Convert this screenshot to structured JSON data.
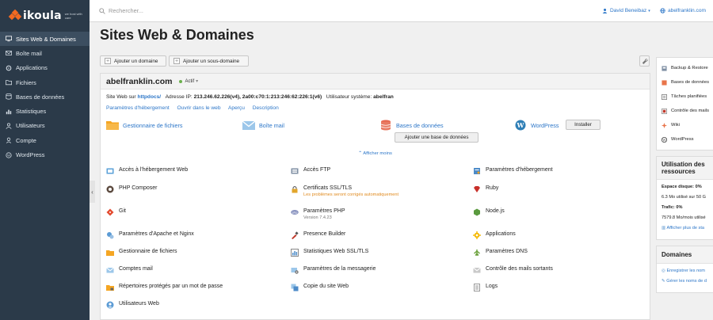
{
  "brand": {
    "name": "ikoula",
    "tagline": "we host with care"
  },
  "sidebar": {
    "items": [
      {
        "label": "Sites Web & Domaines",
        "icon": "monitor-icon",
        "active": true
      },
      {
        "label": "Boîte mail",
        "icon": "mail-icon"
      },
      {
        "label": "Applications",
        "icon": "applications-icon"
      },
      {
        "label": "Fichiers",
        "icon": "folder-icon"
      },
      {
        "label": "Bases de données",
        "icon": "database-icon"
      },
      {
        "label": "Statistiques",
        "icon": "statistics-icon"
      },
      {
        "label": "Utilisateurs",
        "icon": "users-icon"
      },
      {
        "label": "Compte",
        "icon": "account-icon"
      },
      {
        "label": "WordPress",
        "icon": "wordpress-icon"
      }
    ]
  },
  "header": {
    "search_placeholder": "Rechercher...",
    "user_name": "David Beneibaz",
    "domain": "abelfranklin.com"
  },
  "page": {
    "title": "Sites Web & Domaines",
    "add_domain": "Ajouter un domaine",
    "add_subdomain": "Ajouter un sous-domaine"
  },
  "site": {
    "name": "abelfranklin.com",
    "status": "Actif",
    "info_prefix": "Site Web sur",
    "docroot": "httpdocs/",
    "ip_label": "Adresse IP:",
    "ip_value": "213.246.62.226(v4), 2a00:c70:1:213:246:62:226:1(v6)",
    "sysuser_label": "Utilisateur système:",
    "sysuser_value": "abelfran",
    "links": [
      "Paramètres d'hébergement",
      "Ouvrir dans le web",
      "Aperçu",
      "Description"
    ],
    "quick": [
      {
        "label": "Gestionnaire de fichiers",
        "icon": "folder-icon"
      },
      {
        "label": "Boîte mail",
        "icon": "mail-icon"
      },
      {
        "label": "Bases de données",
        "icon": "database-icon"
      },
      {
        "label": "WordPress",
        "icon": "wordpress-icon"
      }
    ],
    "install_button": "Installer",
    "add_db_button": "Ajouter une base de données",
    "show_less": "⌃ Afficher moins"
  },
  "features": [
    {
      "label": "Accès à l'hébergement Web",
      "icon": "web-access-icon"
    },
    {
      "label": "Accès FTP",
      "icon": "ftp-icon"
    },
    {
      "label": "Paramètres d'hébergement",
      "icon": "hosting-settings-icon"
    },
    {
      "label": "PHP Composer",
      "icon": "php-composer-icon"
    },
    {
      "label": "Certificats SSL/TLS",
      "icon": "ssl-certificate-icon",
      "sub": "Les problèmes seront corrigés automatiquement"
    },
    {
      "label": "Ruby",
      "icon": "ruby-icon"
    },
    {
      "label": "Git",
      "icon": "git-icon"
    },
    {
      "label": "Paramètres PHP",
      "icon": "php-icon",
      "sub": "Version 7.4.23"
    },
    {
      "label": "Node.js",
      "icon": "nodejs-icon"
    },
    {
      "label": "Paramètres d'Apache et Nginx",
      "icon": "apache-nginx-icon"
    },
    {
      "label": "Presence Builder",
      "icon": "presence-builder-icon"
    },
    {
      "label": "Applications",
      "icon": "applications-icon"
    },
    {
      "label": "Gestionnaire de fichiers",
      "icon": "folder-icon"
    },
    {
      "label": "Statistiques Web SSL/TLS",
      "icon": "web-stats-icon"
    },
    {
      "label": "Paramètres DNS",
      "icon": "dns-icon"
    },
    {
      "label": "Comptes mail",
      "icon": "mail-accounts-icon"
    },
    {
      "label": "Paramètres de la messagerie",
      "icon": "mail-settings-icon"
    },
    {
      "label": "Contrôle des mails sortants",
      "icon": "outgoing-mail-icon"
    },
    {
      "label": "Répertoires protégés par un mot de passe",
      "icon": "protected-dirs-icon"
    },
    {
      "label": "Copie du site Web",
      "icon": "site-copy-icon"
    },
    {
      "label": "Logs",
      "icon": "logs-icon"
    },
    {
      "label": "Utilisateurs Web",
      "icon": "web-users-icon"
    }
  ],
  "right": {
    "tools": [
      {
        "label": "Backup & Restore",
        "icon": "backup-icon"
      },
      {
        "label": "Bases de données",
        "icon": "database-icon"
      },
      {
        "label": "Tâches planifiées",
        "icon": "scheduled-tasks-icon"
      },
      {
        "label": "Contrôle des mails",
        "icon": "mail-control-icon"
      },
      {
        "label": "Wiki",
        "icon": "wiki-icon"
      },
      {
        "label": "WordPress",
        "icon": "wordpress-icon"
      }
    ],
    "usage": {
      "title": "Utilisation des ressources",
      "disk": "Espace disque: 0%",
      "disk_detail": "6.3 Mo utilisé sur 50 G",
      "traffic": "Trafic: 0%",
      "traffic_detail": "7579.8 Mo/mois utilisé",
      "more": "Afficher plus de sta"
    },
    "domains": {
      "title": "Domaines",
      "register": "Enregistrer les nom",
      "manage": "Gérer les noms de d"
    }
  }
}
